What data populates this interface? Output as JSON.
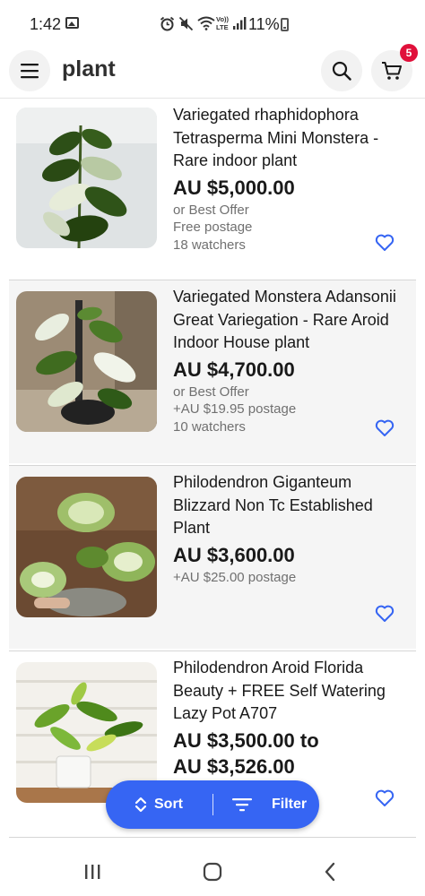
{
  "status_bar": {
    "time": "1:42",
    "icons": [
      "gallery-icon",
      "alarm-icon",
      "mute-icon",
      "wifi-icon",
      "volte-icon",
      "signal-icon"
    ],
    "volte_label": "Vo)) LTE",
    "battery": "11%"
  },
  "header": {
    "title": "plant",
    "cart_count": "5"
  },
  "listings": [
    {
      "title": "Variegated rhaphidophora Tetrasperma Mini Monstera - Rare indoor plant",
      "price": "AU $5,000.00",
      "meta": [
        "or Best Offer",
        "Free postage",
        "18 watchers"
      ]
    },
    {
      "title": "Variegated Monstera Adansonii Great Variegation - Rare Aroid Indoor House plant",
      "price": "AU $4,700.00",
      "meta": [
        "or Best Offer",
        "+AU $19.95 postage",
        "10 watchers"
      ]
    },
    {
      "title": "Philodendron Giganteum Blizzard Non Tc Established Plant",
      "price": "AU $3,600.00",
      "meta": [
        "+AU $25.00 postage"
      ]
    },
    {
      "title": "Philodendron Aroid Florida Beauty + FREE Self Watering Lazy Pot A707",
      "price": "AU $3,500.00 to",
      "price2": "AU $3,526.00",
      "meta": []
    }
  ],
  "actions": {
    "sort_label": "Sort",
    "filter_label": "Filter"
  },
  "colors": {
    "accent": "#3665f3",
    "badge": "#e0103a",
    "meta_text": "#707070"
  }
}
